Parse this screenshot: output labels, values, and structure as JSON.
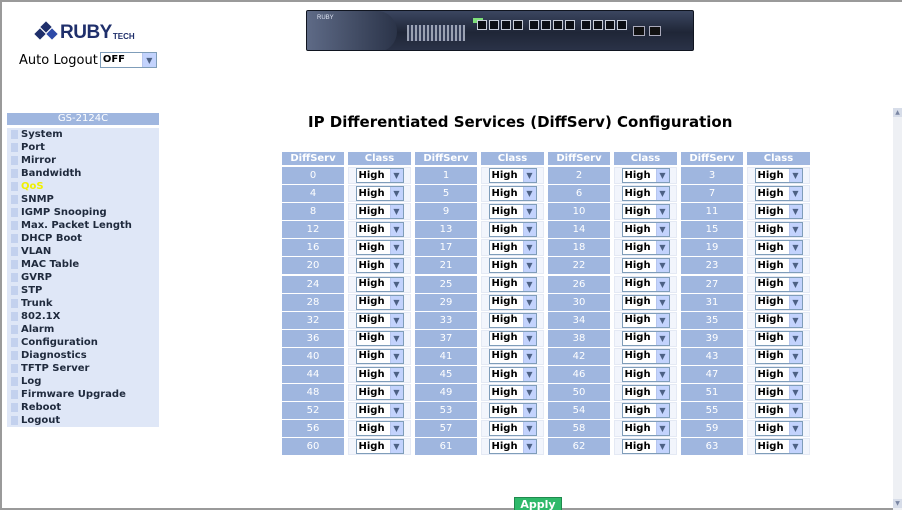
{
  "logo": {
    "brand": "RUBY",
    "suffix": "TECH"
  },
  "autologout": {
    "label": "Auto Logout",
    "selected": "OFF"
  },
  "device_banner": {
    "brand": "RUBY"
  },
  "sidebar": {
    "header": "GS-2124C",
    "items": [
      {
        "label": "System",
        "active": false
      },
      {
        "label": "Port",
        "active": false
      },
      {
        "label": "Mirror",
        "active": false
      },
      {
        "label": "Bandwidth",
        "active": false
      },
      {
        "label": "QoS",
        "active": true
      },
      {
        "label": "SNMP",
        "active": false
      },
      {
        "label": "IGMP Snooping",
        "active": false
      },
      {
        "label": "Max. Packet Length",
        "active": false
      },
      {
        "label": "DHCP Boot",
        "active": false
      },
      {
        "label": "VLAN",
        "active": false
      },
      {
        "label": "MAC Table",
        "active": false
      },
      {
        "label": "GVRP",
        "active": false
      },
      {
        "label": "STP",
        "active": false
      },
      {
        "label": "Trunk",
        "active": false
      },
      {
        "label": "802.1X",
        "active": false
      },
      {
        "label": "Alarm",
        "active": false
      },
      {
        "label": "Configuration",
        "active": false
      },
      {
        "label": "Diagnostics",
        "active": false
      },
      {
        "label": "TFTP Server",
        "active": false
      },
      {
        "label": "Log",
        "active": false
      },
      {
        "label": "Firmware Upgrade",
        "active": false
      },
      {
        "label": "Reboot",
        "active": false
      },
      {
        "label": "Logout",
        "active": false
      }
    ]
  },
  "main": {
    "title": "IP Differentiated Services (DiffServ) Configuration",
    "headers": [
      "DiffServ",
      "Class",
      "DiffServ",
      "Class",
      "DiffServ",
      "Class",
      "DiffServ",
      "Class"
    ],
    "rows": [
      [
        {
          "ds": "0",
          "cls": "High"
        },
        {
          "ds": "1",
          "cls": "High"
        },
        {
          "ds": "2",
          "cls": "High"
        },
        {
          "ds": "3",
          "cls": "High"
        }
      ],
      [
        {
          "ds": "4",
          "cls": "High"
        },
        {
          "ds": "5",
          "cls": "High"
        },
        {
          "ds": "6",
          "cls": "High"
        },
        {
          "ds": "7",
          "cls": "High"
        }
      ],
      [
        {
          "ds": "8",
          "cls": "High"
        },
        {
          "ds": "9",
          "cls": "High"
        },
        {
          "ds": "10",
          "cls": "High"
        },
        {
          "ds": "11",
          "cls": "High"
        }
      ],
      [
        {
          "ds": "12",
          "cls": "High"
        },
        {
          "ds": "13",
          "cls": "High"
        },
        {
          "ds": "14",
          "cls": "High"
        },
        {
          "ds": "15",
          "cls": "High"
        }
      ],
      [
        {
          "ds": "16",
          "cls": "High"
        },
        {
          "ds": "17",
          "cls": "High"
        },
        {
          "ds": "18",
          "cls": "High"
        },
        {
          "ds": "19",
          "cls": "High"
        }
      ],
      [
        {
          "ds": "20",
          "cls": "High"
        },
        {
          "ds": "21",
          "cls": "High"
        },
        {
          "ds": "22",
          "cls": "High"
        },
        {
          "ds": "23",
          "cls": "High"
        }
      ],
      [
        {
          "ds": "24",
          "cls": "High"
        },
        {
          "ds": "25",
          "cls": "High"
        },
        {
          "ds": "26",
          "cls": "High"
        },
        {
          "ds": "27",
          "cls": "High"
        }
      ],
      [
        {
          "ds": "28",
          "cls": "High"
        },
        {
          "ds": "29",
          "cls": "High"
        },
        {
          "ds": "30",
          "cls": "High"
        },
        {
          "ds": "31",
          "cls": "High"
        }
      ],
      [
        {
          "ds": "32",
          "cls": "High"
        },
        {
          "ds": "33",
          "cls": "High"
        },
        {
          "ds": "34",
          "cls": "High"
        },
        {
          "ds": "35",
          "cls": "High"
        }
      ],
      [
        {
          "ds": "36",
          "cls": "High"
        },
        {
          "ds": "37",
          "cls": "High"
        },
        {
          "ds": "38",
          "cls": "High"
        },
        {
          "ds": "39",
          "cls": "High"
        }
      ],
      [
        {
          "ds": "40",
          "cls": "High"
        },
        {
          "ds": "41",
          "cls": "High"
        },
        {
          "ds": "42",
          "cls": "High"
        },
        {
          "ds": "43",
          "cls": "High"
        }
      ],
      [
        {
          "ds": "44",
          "cls": "High"
        },
        {
          "ds": "45",
          "cls": "High"
        },
        {
          "ds": "46",
          "cls": "High"
        },
        {
          "ds": "47",
          "cls": "High"
        }
      ],
      [
        {
          "ds": "48",
          "cls": "High"
        },
        {
          "ds": "49",
          "cls": "High"
        },
        {
          "ds": "50",
          "cls": "High"
        },
        {
          "ds": "51",
          "cls": "High"
        }
      ],
      [
        {
          "ds": "52",
          "cls": "High"
        },
        {
          "ds": "53",
          "cls": "High"
        },
        {
          "ds": "54",
          "cls": "High"
        },
        {
          "ds": "55",
          "cls": "High"
        }
      ],
      [
        {
          "ds": "56",
          "cls": "High"
        },
        {
          "ds": "57",
          "cls": "High"
        },
        {
          "ds": "58",
          "cls": "High"
        },
        {
          "ds": "59",
          "cls": "High"
        }
      ],
      [
        {
          "ds": "60",
          "cls": "High"
        },
        {
          "ds": "61",
          "cls": "High"
        },
        {
          "ds": "62",
          "cls": "High"
        },
        {
          "ds": "63",
          "cls": "High"
        }
      ]
    ],
    "apply_label": "Apply"
  },
  "colors": {
    "header_blue": "#9fb6df",
    "sidebar_bg": "#dfe7f7",
    "active_item": "#f0f000",
    "apply_green": "#2fb96a"
  }
}
